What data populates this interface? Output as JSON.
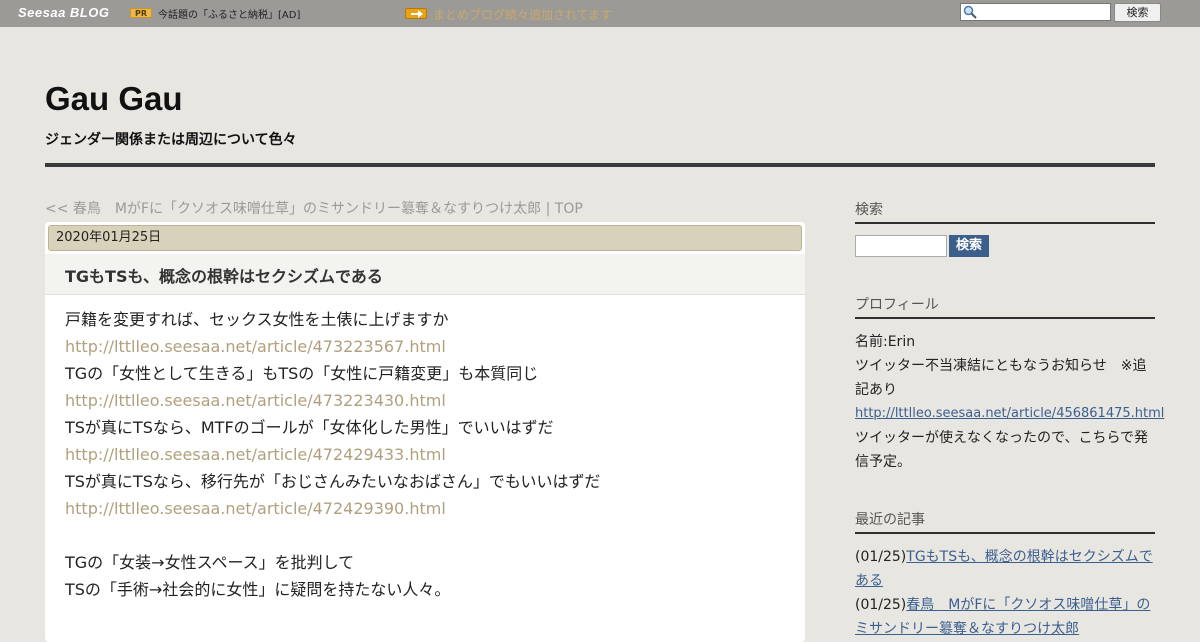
{
  "topbar": {
    "logo": "Seesaa BLOG",
    "pr_badge": "PR",
    "pr_text": "今話題の「ふるさと納税」[AD]",
    "announcement": "まとめブログ続々追加されてます",
    "search_button": "検索"
  },
  "header": {
    "title": "Gau Gau",
    "description": "ジェンダー関係または周辺について色々"
  },
  "article_nav": {
    "text": "<< 春鳥　MがFに「クソオス味噌仕草」のミサンドリー簒奪＆なすりつけ太郎 | TOP"
  },
  "article": {
    "date": "2020年01月25日",
    "title": "TGもTSも、概念の根幹はセクシズムである",
    "lines": [
      "戸籍を変更すれば、セックス女性を土俵に上げますか",
      "http://lttlleo.seesaa.net/article/473223567.html",
      "TGの「女性として生きる」もTSの「女性に戸籍変更」も本質同じ",
      "http://lttlleo.seesaa.net/article/473223430.html",
      "TSが真にTSなら、MTFのゴールが「女体化した男性」でいいはずだ",
      "http://lttlleo.seesaa.net/article/472429433.html",
      "TSが真にTSなら、移行先が「おじさんみたいなおばさん」でもいいはずだ",
      "http://lttlleo.seesaa.net/article/472429390.html",
      "",
      "TGの「女装→女性スペース」を批判して",
      "TSの「手術→社会的に女性」に疑問を持たない人々。"
    ]
  },
  "sidebar": {
    "search": {
      "heading": "検索",
      "button": "検索"
    },
    "profile": {
      "heading": "プロフィール",
      "name": "名前:Erin",
      "notice": "ツイッター不当凍結にともなうお知らせ　※追記あり",
      "link": "http://lttlleo.seesaa.net/article/456861475.html",
      "note": "ツイッターが使えなくなったので、こちらで発信予定。"
    },
    "recent": {
      "heading": "最近の記事",
      "items": [
        {
          "date": "(01/25)",
          "title": "TGもTSも、概念の根幹はセクシズムである"
        },
        {
          "date": "(01/25)",
          "title": "春鳥　MがFに「クソオス味噌仕草」のミサンドリー簒奪＆なすりつけ太郎"
        }
      ]
    }
  },
  "colors": {
    "topbar": "#9c9a97",
    "background": "#e8e6e1",
    "date_bar": "#d9d2bb",
    "link_muted": "#b0a07e",
    "sidebar_link": "#3c5f91"
  }
}
